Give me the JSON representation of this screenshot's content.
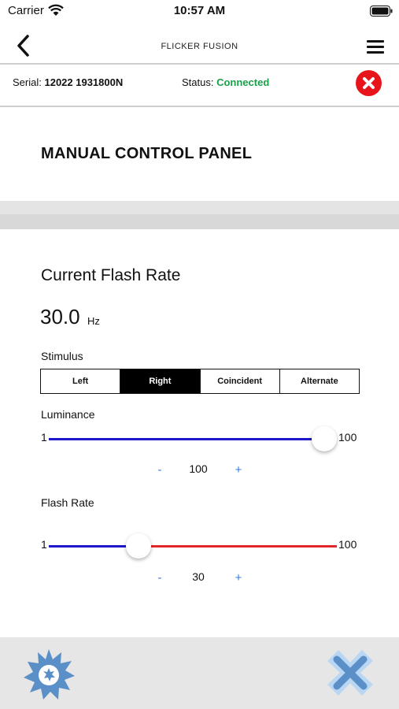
{
  "status_bar": {
    "carrier": "Carrier",
    "time": "10:57 AM"
  },
  "nav": {
    "title": "FLICKER FUSION"
  },
  "device": {
    "serial_label": "Serial:",
    "serial_value": "12022 1931800N",
    "status_label": "Status:",
    "status_value": "Connected"
  },
  "colors": {
    "connected": "#1aa04a",
    "close": "#e8141c",
    "slider_low": "#1a18c8",
    "slider_high": "#e3262a",
    "accent": "#2b7be0",
    "icon_blue": "#5b8fc8"
  },
  "panel": {
    "title": "MANUAL CONTROL PANEL"
  },
  "flash_rate": {
    "label": "Current Flash Rate",
    "value": "30.0",
    "unit": "Hz"
  },
  "stimulus": {
    "label": "Stimulus",
    "options": [
      "Left",
      "Right",
      "Coincident",
      "Alternate"
    ],
    "selected": "Right"
  },
  "luminance": {
    "label": "Luminance",
    "min": "1",
    "max": "100",
    "value": "100",
    "minus": "-",
    "plus": "+"
  },
  "flash_rate_slider": {
    "label": "Flash Rate",
    "min": "1",
    "max": "100",
    "value": "30",
    "minus": "-",
    "plus": "+"
  },
  "bottom": {
    "left_icon": "starburst-icon",
    "right_icon": "cross-icon"
  }
}
